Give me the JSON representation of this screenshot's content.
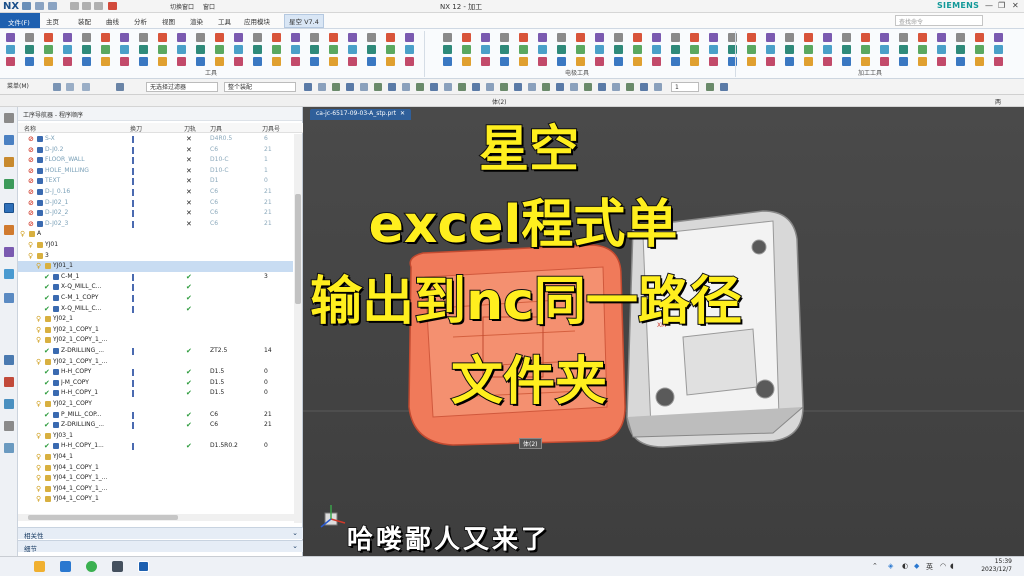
{
  "titlebar": {
    "logo": "NX",
    "quick_btn_1": "切换窗口",
    "quick_btn_2": "窗口",
    "title": "NX 12 - 加工",
    "brand": "SIEMENS",
    "minimize": "—",
    "restore": "❐",
    "close": "✕"
  },
  "menubar": {
    "tabs": [
      "文件(F)",
      "主页",
      "装配",
      "曲线",
      "分析",
      "视图",
      "渲染",
      "工具",
      "应用模块",
      "星空 V7.4"
    ],
    "search_placeholder": "查找命令"
  },
  "ribbon": {
    "groups": [
      "工具",
      "电极工具",
      "加工工具"
    ]
  },
  "selbar": {
    "menu_label": "菜单(M)",
    "filter": "无选择过滤器",
    "scope": "整个装配",
    "count": "1"
  },
  "partbar": {
    "center": "体(2)",
    "right": "两"
  },
  "navigator": {
    "title": "工序导航器 - 程序顺序",
    "columns": [
      "名称",
      "换刀",
      "刀轨",
      "刀具",
      "刀具号"
    ],
    "rows": [
      {
        "name": "S-X",
        "tool": "D4R0.5",
        "num": "6",
        "path": "x",
        "grey": true,
        "indent": 1
      },
      {
        "name": "D-J0.2",
        "tool": "C6",
        "num": "21",
        "path": "x",
        "grey": true,
        "indent": 1
      },
      {
        "name": "FLOOR_WALL",
        "tool": "D10-C",
        "num": "1",
        "path": "x",
        "grey": true,
        "indent": 1
      },
      {
        "name": "HOLE_MILLING",
        "tool": "D10-C",
        "num": "1",
        "path": "x",
        "grey": true,
        "indent": 1
      },
      {
        "name": "TEXT",
        "tool": "D1",
        "num": "0",
        "path": "x",
        "grey": true,
        "indent": 1
      },
      {
        "name": "D-J_0.16",
        "tool": "C6",
        "num": "21",
        "path": "x",
        "grey": true,
        "indent": 1
      },
      {
        "name": "D-J02_1",
        "tool": "C6",
        "num": "21",
        "path": "x",
        "grey": true,
        "indent": 1
      },
      {
        "name": "D-J02_2",
        "tool": "C6",
        "num": "21",
        "path": "x",
        "grey": true,
        "indent": 1
      },
      {
        "name": "D-J02_3",
        "tool": "C6",
        "num": "21",
        "path": "x",
        "grey": true,
        "indent": 1
      },
      {
        "name": "A",
        "tool": "",
        "num": "",
        "path": "",
        "grey": false,
        "indent": 0
      },
      {
        "name": "YJ01",
        "tool": "",
        "num": "",
        "path": "",
        "grey": false,
        "indent": 1
      },
      {
        "name": "3",
        "tool": "",
        "num": "",
        "path": "",
        "grey": false,
        "indent": 1
      },
      {
        "name": "YJ01_1",
        "tool": "",
        "num": "",
        "path": "",
        "grey": false,
        "indent": 2,
        "sel": true
      },
      {
        "name": "C-M_1",
        "tool": "",
        "num": "3",
        "path": "v",
        "grey": false,
        "indent": 3
      },
      {
        "name": "X-Q_MILL_C...",
        "tool": "",
        "num": "",
        "path": "v",
        "grey": false,
        "indent": 3
      },
      {
        "name": "C-M_1_COPY",
        "tool": "",
        "num": "",
        "path": "v",
        "grey": false,
        "indent": 3
      },
      {
        "name": "X-Q_MILL_C...",
        "tool": "",
        "num": "",
        "path": "v",
        "grey": false,
        "indent": 3
      },
      {
        "name": "YJ02_1",
        "tool": "",
        "num": "",
        "path": "",
        "grey": false,
        "indent": 2
      },
      {
        "name": "YJ02_1_COPY_1",
        "tool": "",
        "num": "",
        "path": "",
        "grey": false,
        "indent": 2
      },
      {
        "name": "YJ02_1_COPY_1_...",
        "tool": "",
        "num": "",
        "path": "",
        "grey": false,
        "indent": 2
      },
      {
        "name": "Z-DRILLING_...",
        "tool": "ZT2.5",
        "num": "14",
        "path": "v",
        "grey": false,
        "indent": 3
      },
      {
        "name": "YJ02_1_COPY_1_...",
        "tool": "",
        "num": "",
        "path": "",
        "grey": false,
        "indent": 2
      },
      {
        "name": "H-H_COPY",
        "tool": "D1.5",
        "num": "0",
        "path": "v",
        "grey": false,
        "indent": 3
      },
      {
        "name": "J-M_COPY",
        "tool": "D1.5",
        "num": "0",
        "path": "v",
        "grey": false,
        "indent": 3
      },
      {
        "name": "H-H_COPY_1",
        "tool": "D1.5",
        "num": "0",
        "path": "v",
        "grey": false,
        "indent": 3
      },
      {
        "name": "YJ02_1_COPY",
        "tool": "",
        "num": "",
        "path": "",
        "grey": false,
        "indent": 2
      },
      {
        "name": "P_MILL_COP...",
        "tool": "C6",
        "num": "21",
        "path": "v",
        "grey": false,
        "indent": 3
      },
      {
        "name": "Z-DRILLING_...",
        "tool": "C6",
        "num": "21",
        "path": "v",
        "grey": false,
        "indent": 3
      },
      {
        "name": "YJ03_1",
        "tool": "",
        "num": "",
        "path": "",
        "grey": false,
        "indent": 2
      },
      {
        "name": "H-H_COPY_1...",
        "tool": "D1.5R0.2",
        "num": "0",
        "path": "v",
        "grey": false,
        "indent": 3
      },
      {
        "name": "YJ04_1",
        "tool": "",
        "num": "",
        "path": "",
        "grey": false,
        "indent": 2
      },
      {
        "name": "YJ04_1_COPY_1",
        "tool": "",
        "num": "",
        "path": "",
        "grey": false,
        "indent": 2
      },
      {
        "name": "YJ04_1_COPY_1_...",
        "tool": "",
        "num": "",
        "path": "",
        "grey": false,
        "indent": 2
      },
      {
        "name": "YJ04_1_COPY_1_...",
        "tool": "",
        "num": "",
        "path": "",
        "grey": false,
        "indent": 2
      },
      {
        "name": "YJ04_1_COPY_1",
        "tool": "",
        "num": "",
        "path": "",
        "grey": false,
        "indent": 2
      }
    ],
    "sections": [
      "相关性",
      "细节"
    ]
  },
  "graphics": {
    "tab": "ca-jc-6517-09-03-A_stp.prt",
    "overlay_lines": [
      "星空",
      "excel程式单",
      "输出到nc同一路径",
      "文件夹"
    ],
    "subtitle": "哈喽鄙人又来了",
    "body_tag": "体(2)",
    "axis_tag": "XM"
  },
  "taskbar": {
    "time": "15:39",
    "date": "2023/12/7",
    "lang": "英"
  },
  "colors": {
    "accent": "#1e60b0",
    "overlay_text": "#ffef1e",
    "part_orange": "#f07a5a",
    "viewport_bg": "#444444"
  }
}
